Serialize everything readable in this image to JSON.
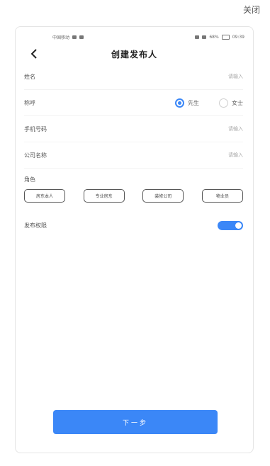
{
  "close_label": "关闭",
  "status_bar": {
    "carrier": "中国移动",
    "battery": "68%",
    "time": "09:39"
  },
  "header": {
    "title": "创建发布人"
  },
  "form": {
    "name": {
      "label": "姓名",
      "placeholder": "请输入"
    },
    "title": {
      "label": "称呼",
      "options": [
        {
          "label": "先生",
          "checked": true
        },
        {
          "label": "女士",
          "checked": false
        }
      ]
    },
    "phone": {
      "label": "手机号码",
      "placeholder": "请输入"
    },
    "company": {
      "label": "公司名称",
      "placeholder": "请输入"
    },
    "role": {
      "label": "角色",
      "options": [
        "房东本人",
        "专业房东",
        "装修公司",
        "物业员"
      ]
    },
    "agreement": {
      "label": "发布权限",
      "enabled": true
    }
  },
  "footer": {
    "next_label": "下一步"
  },
  "colors": {
    "accent": "#3b87f7"
  }
}
